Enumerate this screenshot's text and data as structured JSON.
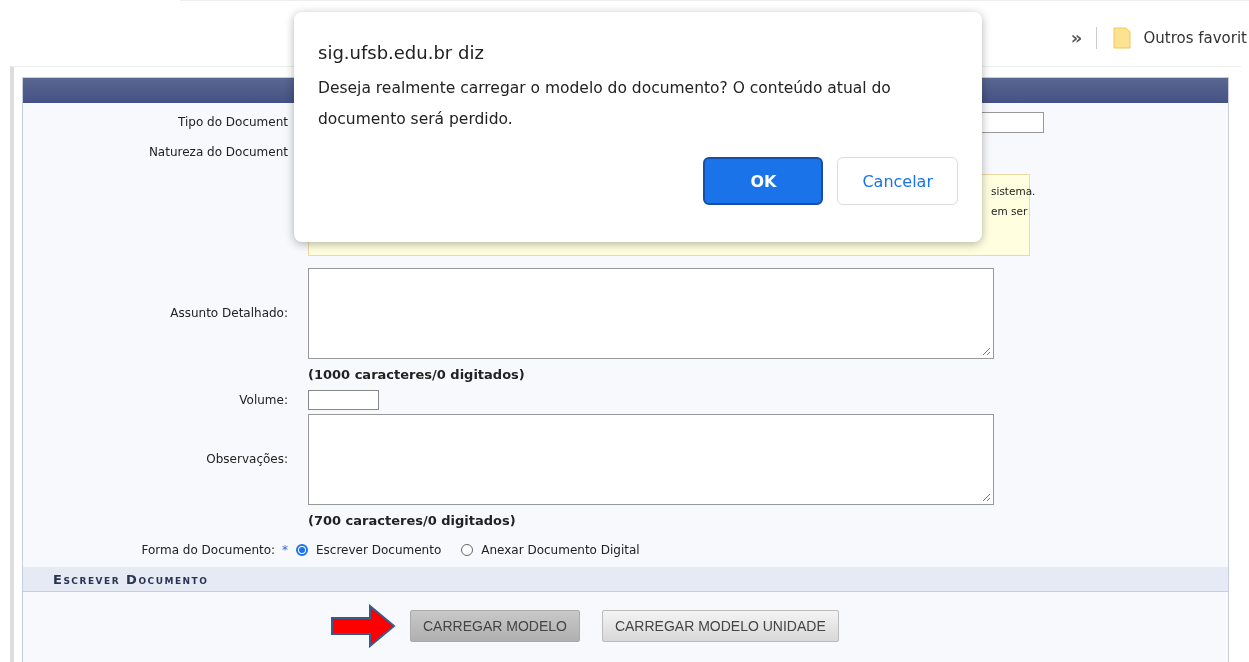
{
  "browser": {
    "bookmarks": [
      {
        "kind": "overflow",
        "label": "»"
      },
      {
        "kind": "folder",
        "label": "Outros favorit"
      }
    ]
  },
  "form": {
    "fields": [
      {
        "kind": "text",
        "label": "Tipo do Document"
      },
      {
        "kind": "plain",
        "label": "Natureza do Document"
      },
      {
        "kind": "notice",
        "lines": [
          "sistema.",
          "em ser"
        ]
      },
      {
        "kind": "textarea",
        "label": "Assunto Detalhado:",
        "counter": "(1000 caracteres/0 digitados)"
      },
      {
        "kind": "short",
        "label": "Volume:"
      },
      {
        "kind": "textarea",
        "label": "Observações:",
        "counter": "(700 caracteres/0 digitados)"
      },
      {
        "kind": "radio",
        "label": "Forma do Documento:",
        "required": "*",
        "options": [
          {
            "label": "Escrever Documento",
            "selected": true
          },
          {
            "label": "Anexar Documento Digital",
            "selected": false
          }
        ]
      }
    ],
    "section_title": "Escrever Documento",
    "buttons": [
      {
        "label": "CARREGAR MODELO",
        "selected": true
      },
      {
        "label": "CARREGAR MODELO UNIDADE",
        "selected": false
      }
    ]
  },
  "dialog": {
    "origin": "sig.ufsb.edu.br diz",
    "message": "Deseja realmente carregar o modelo do documento? O conteúdo atual do documento será perdido.",
    "buttons": [
      {
        "label": "OK",
        "kind": "primary"
      },
      {
        "label": "Cancelar",
        "kind": "secondary"
      }
    ]
  }
}
